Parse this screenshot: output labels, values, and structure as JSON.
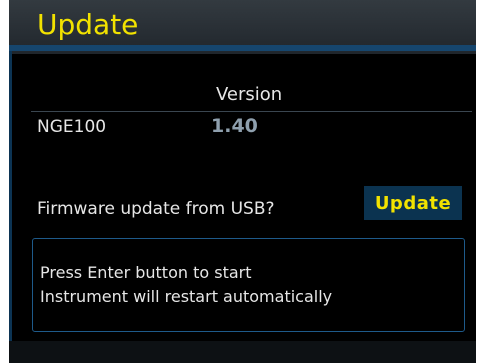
{
  "dialog": {
    "title": "Update"
  },
  "version_table": {
    "column_header": "Version",
    "rows": [
      {
        "device": "NGE100",
        "version": "1.40"
      }
    ]
  },
  "firmware": {
    "prompt": "Firmware update from USB?",
    "update_button_label": "Update"
  },
  "message": {
    "lines": [
      "Press Enter button to start",
      "Instrument will restart automatically"
    ]
  },
  "colors": {
    "title_text": "#f2e200",
    "background": "#000000",
    "button_bg": "#0b3350",
    "accent_blue": "#16466e"
  }
}
